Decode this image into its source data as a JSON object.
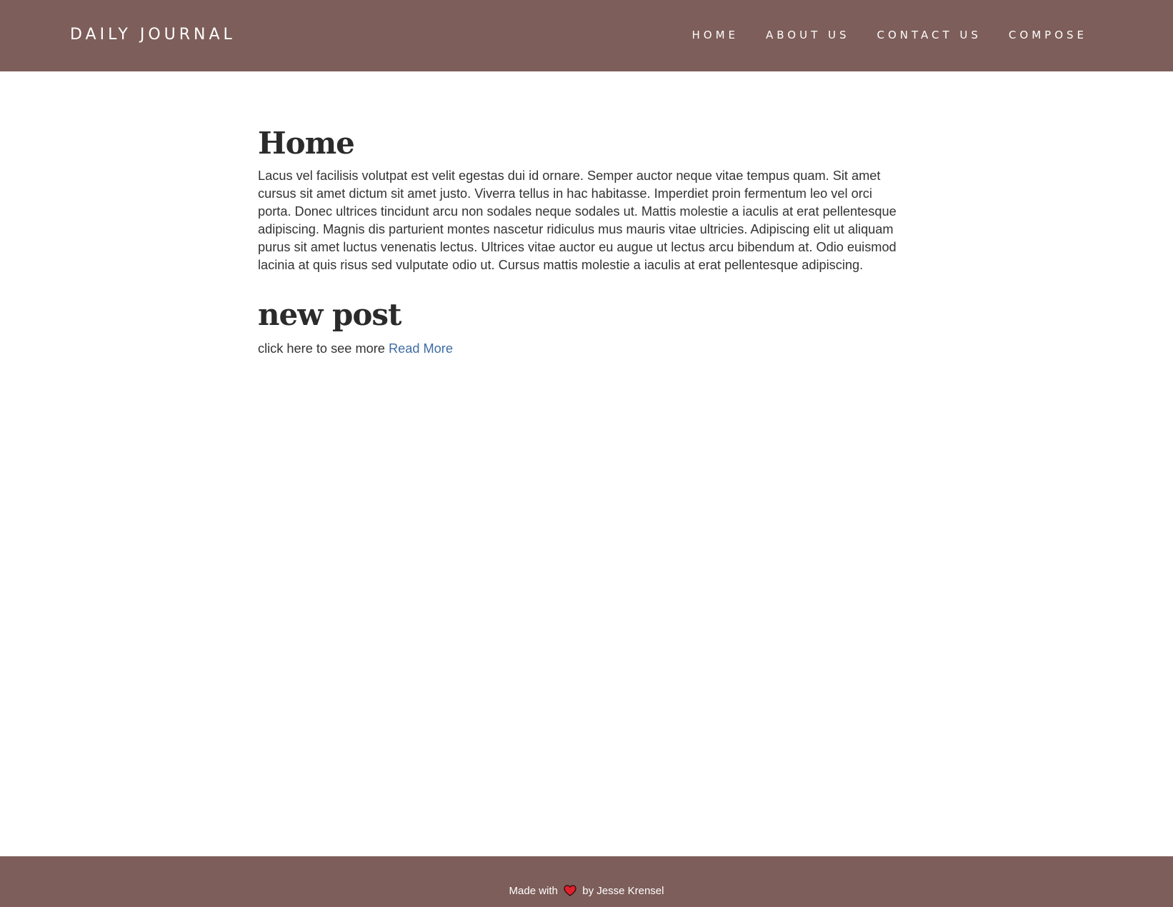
{
  "header": {
    "brand": "DAILY JOURNAL",
    "nav": [
      {
        "label": "HOME"
      },
      {
        "label": "ABOUT US"
      },
      {
        "label": "CONTACT US"
      },
      {
        "label": "COMPOSE"
      }
    ]
  },
  "main": {
    "title": "Home",
    "intro": "Lacus vel facilisis volutpat est velit egestas dui id ornare. Semper auctor neque vitae tempus quam. Sit amet cursus sit amet dictum sit amet justo. Viverra tellus in hac habitasse. Imperdiet proin fermentum leo vel orci porta. Donec ultrices tincidunt arcu non sodales neque sodales ut. Mattis molestie a iaculis at erat pellentesque adipiscing. Magnis dis parturient montes nascetur ridiculus mus mauris vitae ultricies. Adipiscing elit ut aliquam purus sit amet luctus venenatis lectus. Ultrices vitae auctor eu augue ut lectus arcu bibendum at. Odio euismod lacinia at quis risus sed vulputate odio ut. Cursus mattis molestie a iaculis at erat pellentesque adipiscing.",
    "posts": [
      {
        "title": "new post",
        "excerpt": "click here to see more",
        "read_more_label": "Read More"
      }
    ]
  },
  "footer": {
    "made_with": "Made with",
    "heart_icon": "heart-icon",
    "by_author": "by Jesse Krensel"
  },
  "colors": {
    "header_bg": "#7d5e5a",
    "link": "#3f6da3",
    "heart": "#e0202a"
  }
}
